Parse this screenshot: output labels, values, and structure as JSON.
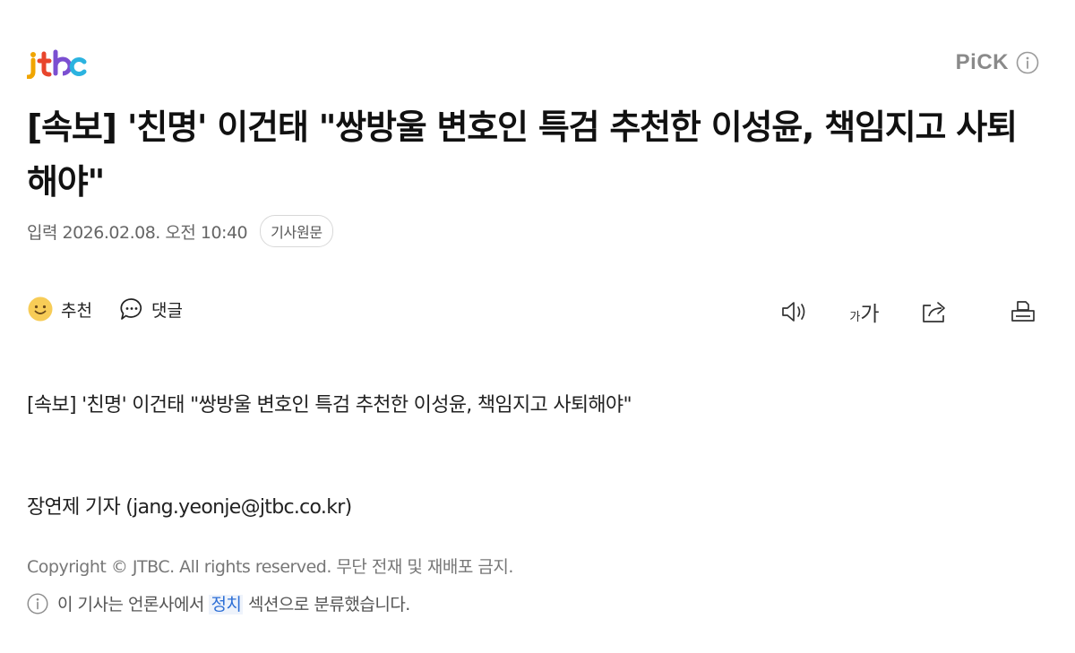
{
  "logo": {
    "text": "jtbc"
  },
  "pick": {
    "label": "PiCK",
    "info_icon": "info-icon"
  },
  "article": {
    "headline": "[속보] '친명' 이건태 \"쌍방울 변호인 특검 추천한 이성윤, 책임지고 사퇴해야\"",
    "date": "입력 2026.02.08. 오전 10:40",
    "origin_button": "기사원문",
    "body": "[속보] '친명' 이건태 \"쌍방울 변호인 특검 추천한 이성윤, 책임지고 사퇴해야\"",
    "reporter": "장연제 기자 (jang.yeonje@jtbc.co.kr)",
    "copyright": "Copyright © JTBC. All rights reserved. 무단 전재 및 재배포 금지.",
    "section_note": {
      "prefix": "이 기사는 언론사에서",
      "section": "정치",
      "suffix": "섹션으로 분류했습니다."
    }
  },
  "actions": {
    "recommend": {
      "label": "추천",
      "icon": "smile-emoji-icon"
    },
    "comment": {
      "label": "댓글",
      "icon": "speech-bubble-icon"
    },
    "tools": [
      {
        "name": "speaker-icon"
      },
      {
        "name": "font-size-icon",
        "small": "가",
        "large": "가"
      },
      {
        "name": "share-icon"
      },
      {
        "name": "print-icon"
      }
    ]
  },
  "colors": {
    "text": "#111111",
    "muted": "#777777",
    "link": "#2d6fd6",
    "logo_j": "#f0a500",
    "logo_t": "#e8452c",
    "logo_b": "#7b4fd1",
    "logo_c": "#2bb3e0"
  }
}
